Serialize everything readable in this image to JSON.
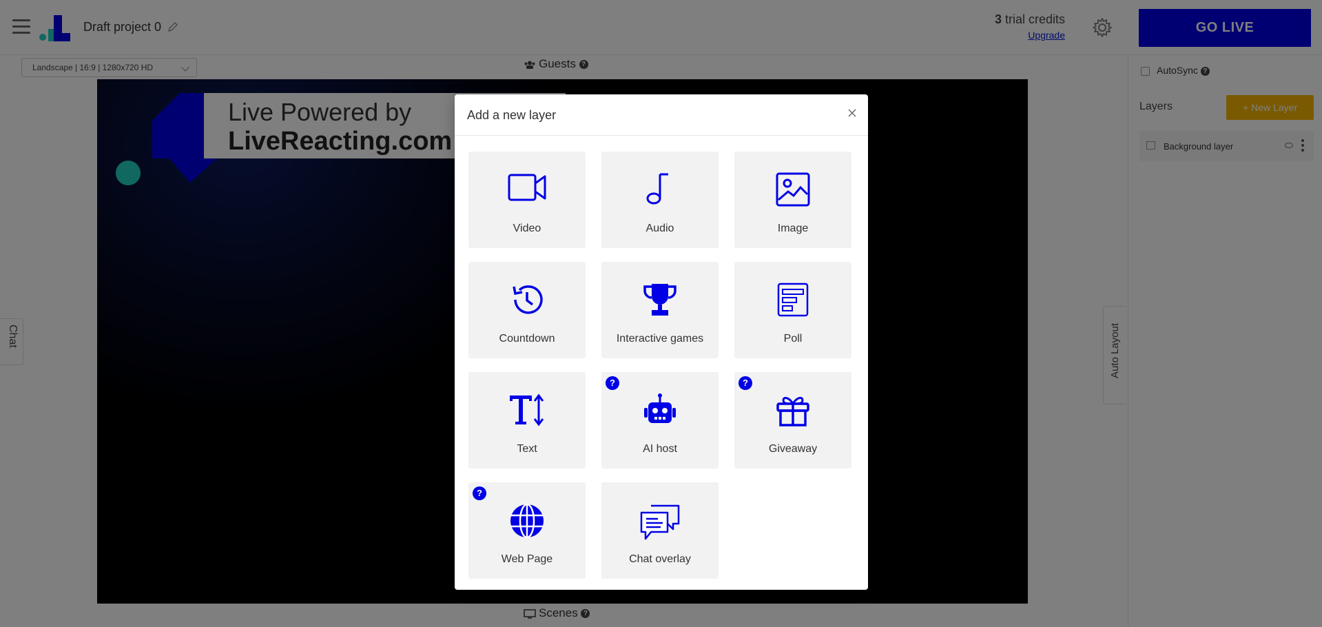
{
  "header": {
    "project_title": "Draft project 0",
    "credits_count": "3",
    "credits_text": " trial credits",
    "upgrade_label": "Upgrade",
    "go_live_label": "GO LIVE"
  },
  "left_tab": {
    "chat_label": "Chat"
  },
  "workspace": {
    "format_value": "Landscape | 16:9 | 1280x720 HD",
    "guests_label": "Guests",
    "scenes_label": "Scenes",
    "watermark_line1": "Live Powered by",
    "watermark_line2": "LiveReacting.com"
  },
  "auto_layout": {
    "label": "Auto Layout"
  },
  "sidebar": {
    "autosync_label": "AutoSync",
    "layers_title": "Layers",
    "new_layer_label": "New Layer",
    "layers": [
      {
        "name": "Background layer"
      }
    ]
  },
  "modal": {
    "title": "Add a new layer",
    "tiles": [
      {
        "label": "Video",
        "icon": "video-icon",
        "help": false
      },
      {
        "label": "Audio",
        "icon": "music-note-icon",
        "help": false
      },
      {
        "label": "Image",
        "icon": "image-icon",
        "help": false
      },
      {
        "label": "Countdown",
        "icon": "countdown-icon",
        "help": false
      },
      {
        "label": "Interactive games",
        "icon": "trophy-icon",
        "help": false
      },
      {
        "label": "Poll",
        "icon": "poll-icon",
        "help": false
      },
      {
        "label": "Text",
        "icon": "text-icon",
        "help": false
      },
      {
        "label": "AI host",
        "icon": "robot-icon",
        "help": true
      },
      {
        "label": "Giveaway",
        "icon": "gift-icon",
        "help": true
      },
      {
        "label": "Web Page",
        "icon": "globe-icon",
        "help": true
      },
      {
        "label": "Chat overlay",
        "icon": "chat-bubbles-icon",
        "help": false
      }
    ],
    "help_glyph": "?"
  },
  "colors": {
    "brand_blue": "#0000e6",
    "accent_yellow": "#f5b400",
    "teal": "#21d0c0"
  }
}
